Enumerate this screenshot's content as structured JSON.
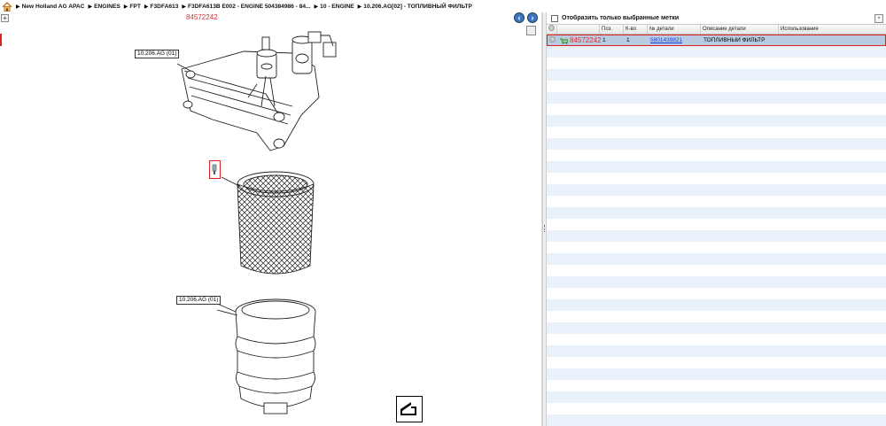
{
  "breadcrumb": [
    "New Holland AG APAC",
    "ENGINES",
    "FPT",
    "F3DFA613",
    "F3DFA613B E002 - ENGINE 504384986 - 84...",
    "10 - ENGINE",
    "10.206.AG[02] - ТОПЛИВНЫЙ ФИЛЬТР"
  ],
  "diagram": {
    "selected_part_number": "84572242",
    "callouts": [
      "10.206.AG (01)",
      "10.206.AG (01)"
    ]
  },
  "parts_panel": {
    "filter_label": "Отобразить только выбранные метки",
    "columns": [
      "",
      "",
      "Поз.",
      "К-во",
      "№ детали",
      "Описание детали",
      "Использование"
    ],
    "rows": [
      {
        "part_ref": "84572242",
        "pos": "1",
        "qty": "1",
        "part_number": "5801439821",
        "description": "ТОПЛИВНЫЙ ФИЛЬТР",
        "usage": ""
      }
    ],
    "empty_row_count": 33
  },
  "colors": {
    "highlight": "#e02020",
    "selected_row": "#b8cbe0",
    "link": "#1a3fd0",
    "nav_button": "#3a76c4"
  }
}
